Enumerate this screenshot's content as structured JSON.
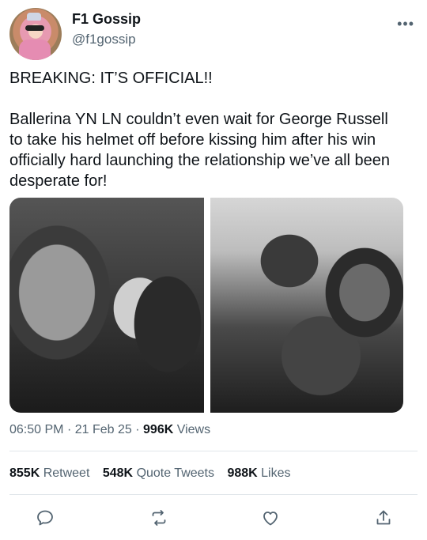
{
  "author": {
    "display_name": "F1 Gossip",
    "handle": "@f1gossip"
  },
  "tweet": {
    "line_1": "BREAKING: IT’S OFFICIAL!!",
    "line_2": "Ballerina YN LN couldn’t even wait for George Russell to take his helmet off before kissing him after his win officially hard launching the relationship we’ve all been desperate for!"
  },
  "media": {
    "photos": [
      "helmet kiss photo (left)",
      "helmet hug photo (right)"
    ]
  },
  "meta": {
    "time": "06:50 PM",
    "date": "21 Feb 25",
    "views_count": "996K",
    "views_label": "Views"
  },
  "stats": {
    "retweets_count": "855K",
    "retweets_label": "Retweet",
    "quotes_count": "548K",
    "quotes_label": "Quote Tweets",
    "likes_count": "988K",
    "likes_label": "Likes"
  },
  "icons": {
    "more": "more-horizontal-icon",
    "reply": "reply-icon",
    "retweet": "retweet-icon",
    "like": "like-icon",
    "share": "share-icon"
  },
  "colors": {
    "text": "#0f1419",
    "secondary": "#536471",
    "divider": "#e1e6ea",
    "icon": "#536471"
  }
}
